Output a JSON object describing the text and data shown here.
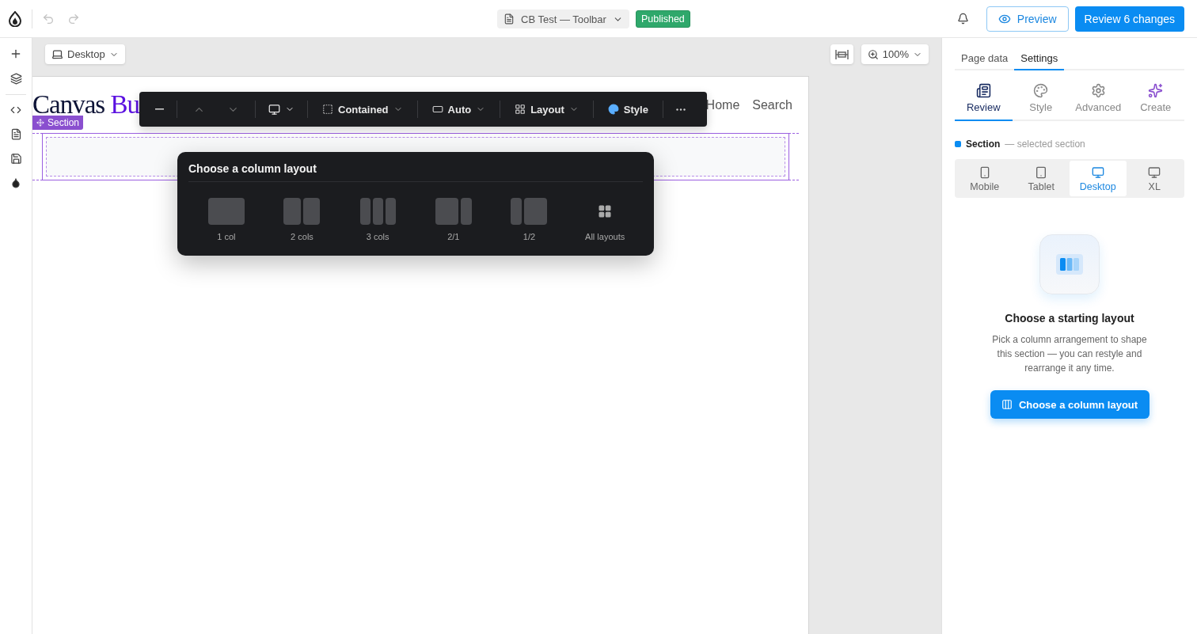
{
  "topbar": {
    "undo_disabled": true,
    "redo_disabled": true,
    "title": "CB Test — Toolbar",
    "status": "Published",
    "preview": "Preview",
    "review": "Review 6 changes"
  },
  "canvas": {
    "viewport": "Desktop",
    "zoom": "100%"
  },
  "page": {
    "logo": "Canvas",
    "logo_accent": "Bu",
    "nav": [
      "Home",
      "Search"
    ],
    "section_label": "Section"
  },
  "toolbar": {
    "move_up_disabled": true,
    "move_down_disabled": true,
    "menus": [
      {
        "label": "Contained"
      },
      {
        "label": "Auto"
      },
      {
        "label": "Layout"
      },
      {
        "label": "Style"
      }
    ]
  },
  "popover": {
    "title": "Choose a column layout",
    "options": [
      {
        "kind": "one",
        "label": "1 col"
      },
      {
        "kind": "two",
        "label": "2 cols"
      },
      {
        "kind": "three",
        "label": "3 cols"
      },
      {
        "kind": "two-one",
        "label": "2/1"
      },
      {
        "kind": "one-two",
        "label": "1/2"
      },
      {
        "kind": "all",
        "label": "All layouts"
      }
    ]
  },
  "panel": {
    "tabs": [
      {
        "label": "Page data",
        "selected": false
      },
      {
        "label": "Settings",
        "selected": true
      }
    ],
    "subtabs": [
      {
        "label": "Review",
        "selected": true
      },
      {
        "label": "Style",
        "selected": false
      },
      {
        "label": "Advanced",
        "selected": false
      },
      {
        "label": "Create",
        "selected": false
      }
    ],
    "section": {
      "name": "Section",
      "note": "— selected section"
    },
    "devices": [
      {
        "label": "Mobile",
        "selected": false
      },
      {
        "label": "Tablet",
        "selected": false
      },
      {
        "label": "Desktop",
        "selected": true
      },
      {
        "label": "XL",
        "selected": false
      }
    ],
    "empty": {
      "title": "Choose a starting layout",
      "text": "Pick a column arrangement to shape this section — you can restyle and rearrange it any time.",
      "button": "Choose a column layout"
    }
  }
}
